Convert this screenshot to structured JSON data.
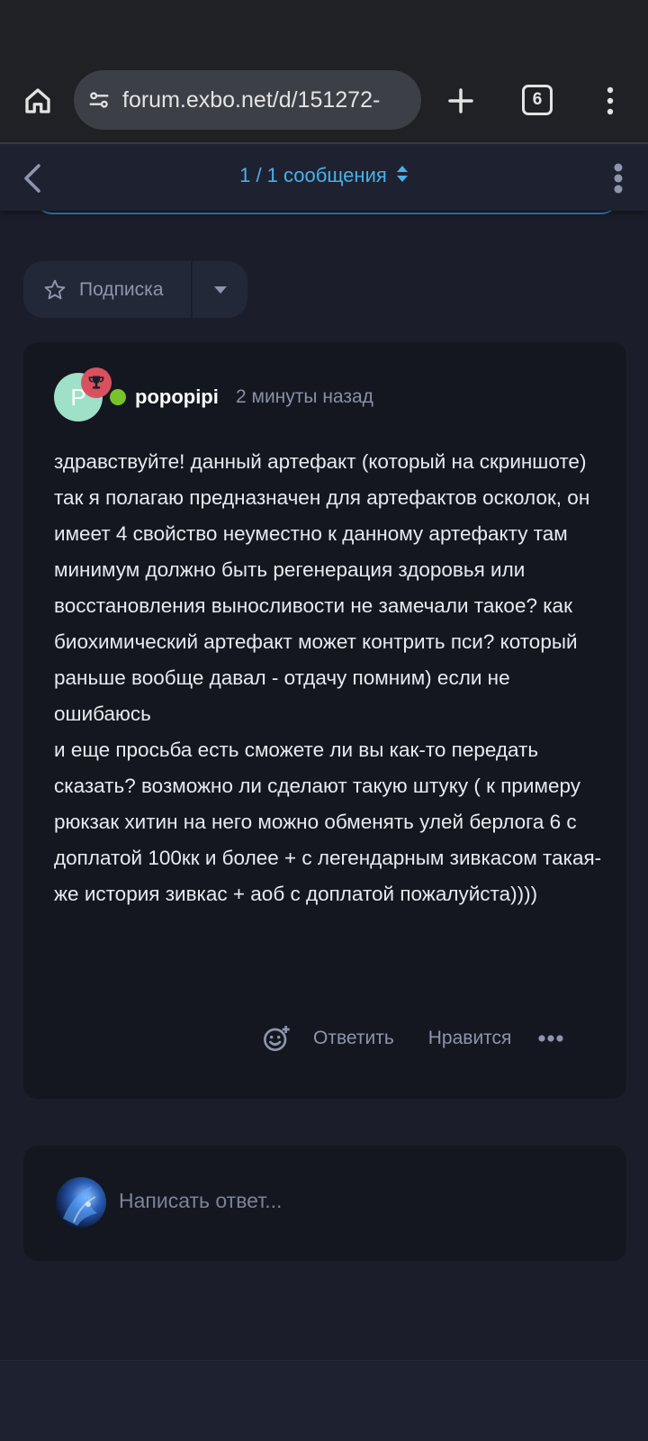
{
  "browser": {
    "url": "forum.exbo.net/d/151272-",
    "tab_count": "6",
    "icons": {
      "home": "home-icon",
      "site_settings": "tune-icon",
      "new_tab": "plus-icon",
      "menu": "more-vertical-icon"
    }
  },
  "discussion_header": {
    "scrubber_label": "1 / 1 сообщения",
    "accent_color": "#4ab0ea"
  },
  "subscribe": {
    "label": "Подписка"
  },
  "post": {
    "avatar_letter": "P",
    "username": "popopipi",
    "time": "2 минуты назад",
    "body": "здравствуйте! данный артефакт (который на скриншоте) так я полагаю предназначен для артефактов осколок, он имеет 4 свойство неуместно к данному артефакту там минимум должно быть регенерация здоровья или восстановления выносливости не замечали такое? как биохимический артефакт может контрить пси? который раньше вообще давал - отдачу помним) если не ошибаюсь\nи еще просьба есть сможете ли вы как-то передать сказать? возможно ли сделают такую штуку ( к примеру рюкзак хитин на него можно обменять улей берлога 6 с доплатой 100кк и более + с легендарным зивкасом такая-же история зивкас + аоб с доплатой пожалуйста))))",
    "actions": {
      "reply": "Ответить",
      "like": "Нравится"
    }
  },
  "composer": {
    "placeholder": "Написать ответ..."
  }
}
